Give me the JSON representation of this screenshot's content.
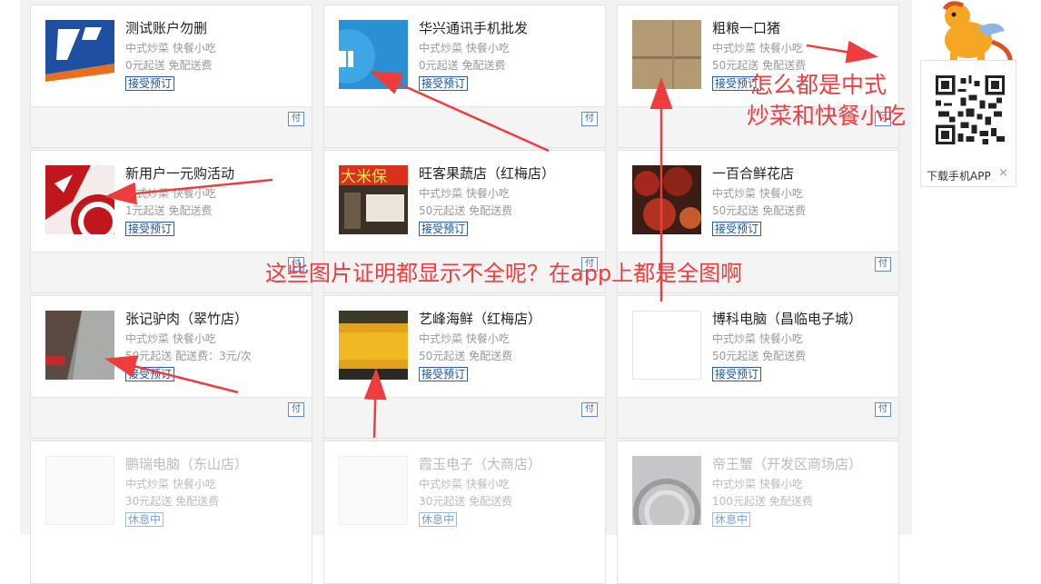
{
  "stores": [
    {
      "name": "测试账户勿删",
      "category": "中式炒菜 快餐小吃",
      "delivery": "0元起送 免配送费",
      "status": "接受预订",
      "pay": "付"
    },
    {
      "name": "华兴通讯手机批发",
      "category": "中式炒菜 快餐小吃",
      "delivery": "0元起送 免配送费",
      "status": "接受预订",
      "pay": "付"
    },
    {
      "name": "粗粮一口猪",
      "category": "中式炒菜 快餐小吃",
      "delivery": "50元起送 免配送费",
      "status": "接受预订",
      "pay": "付"
    },
    {
      "name": "新用户一元购活动",
      "category": "中式炒菜 快餐小吃",
      "delivery": "1元起送 免配送费",
      "status": "接受预订",
      "pay": "付"
    },
    {
      "name": "旺客果蔬店（红梅店）",
      "category": "中式炒菜 快餐小吃",
      "delivery": "50元起送 免配送费",
      "status": "接受预订",
      "pay": "付"
    },
    {
      "name": "一百合鲜花店",
      "category": "中式炒菜 快餐小吃",
      "delivery": "50元起送 免配送费",
      "status": "接受预订",
      "pay": "付"
    },
    {
      "name": "张记驴肉（翠竹店）",
      "category": "中式炒菜 快餐小吃",
      "delivery": "50元起送 配送费：3元/次",
      "status": "接受预订",
      "pay": "付"
    },
    {
      "name": "艺峰海鲜（红梅店）",
      "category": "中式炒菜 快餐小吃",
      "delivery": "50元起送 免配送费",
      "status": "接受预订",
      "pay": "付"
    },
    {
      "name": "博科电脑（昌临电子城）",
      "category": "中式炒菜 快餐小吃",
      "delivery": "50元起送 免配送费",
      "status": "接受预订",
      "pay": "付"
    },
    {
      "name": "鹏瑞电脑（东山店）",
      "category": "中式炒菜 快餐小吃",
      "delivery": "30元起送 免配送费",
      "status": "休息中",
      "pay": ""
    },
    {
      "name": "霞玉电子（大商店）",
      "category": "中式炒菜 快餐小吃",
      "delivery": "30元起送 免配送费",
      "status": "休息中",
      "pay": ""
    },
    {
      "name": "帝王蟹（开发区商场店）",
      "category": "中式炒菜 快餐小吃",
      "delivery": "100元起送 免配送费",
      "status": "休息中",
      "pay": ""
    }
  ],
  "sidebar": {
    "download_label": "下载手机APP",
    "close_icon": "×"
  },
  "annotations": {
    "note1_line1": "怎么都是中式",
    "note1_line2": "炒菜和快餐小吃",
    "note2": "这些图片证明都显示不全呢？在app上都是全图啊",
    "color": "#ef3c3c"
  },
  "thumb_text": {
    "store5_sign": "大米保"
  }
}
